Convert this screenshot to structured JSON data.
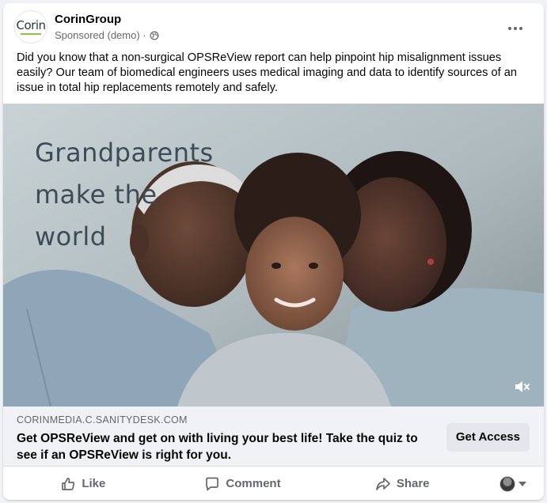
{
  "post": {
    "page_name": "CorinGroup",
    "avatar_text": "Corin",
    "sponsored_label": "Sponsored (demo) ·",
    "body_text": "Did you know that a non-surgical OPSReView report can help pinpoint hip misalignment issues easily? Our team of biomedical engineers uses medical imaging and data to identify sources of an issue in total hip replacements remotely and safely."
  },
  "media": {
    "overlay_lines": [
      "Grandparents",
      "make the",
      "world"
    ]
  },
  "link_preview": {
    "domain": "CORINMEDIA.C.SANITYDESK.COM",
    "headline": "Get OPSReView and get on with living your best life! Take the quiz to see if an OPSReView is right for you.",
    "cta_label": "Get Access"
  },
  "actions": {
    "like": "Like",
    "comment": "Comment",
    "share": "Share"
  },
  "colors": {
    "secondary_text": "#65676b",
    "card_bg": "#ffffff",
    "preview_bg": "#f0f2f5",
    "overlay_text": "#3d4b56"
  },
  "icons": [
    "globe-icon",
    "more-icon",
    "mute-icon",
    "like-icon",
    "comment-icon",
    "share-icon",
    "chevron-down-icon"
  ]
}
